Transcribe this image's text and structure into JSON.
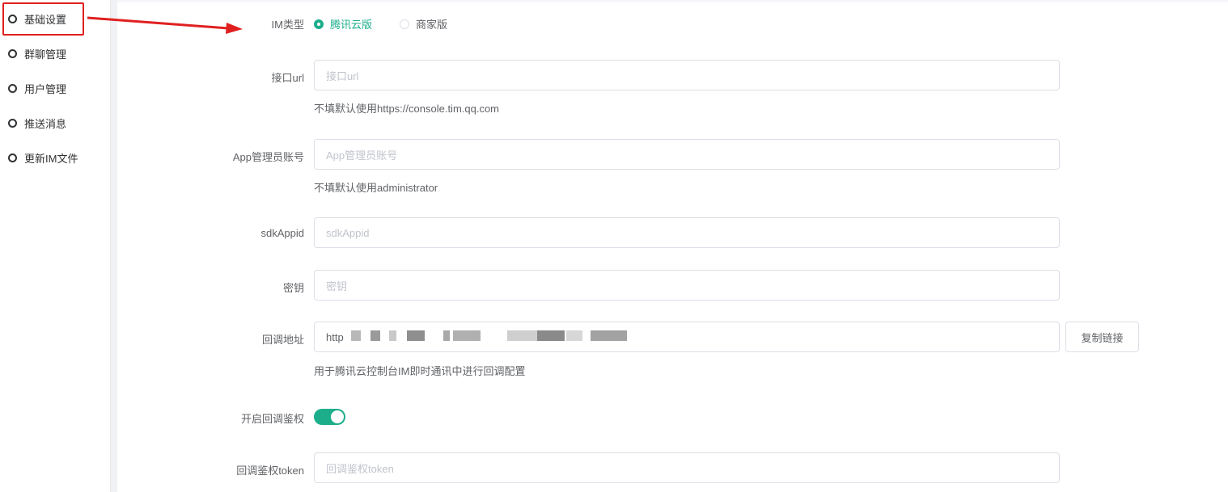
{
  "sidebar": {
    "items": [
      {
        "label": "基础设置"
      },
      {
        "label": "群聊管理"
      },
      {
        "label": "用户管理"
      },
      {
        "label": "推送消息"
      },
      {
        "label": "更新IM文件"
      }
    ]
  },
  "form": {
    "im_type": {
      "label": "IM类型",
      "options": [
        "腾讯云版",
        "商家版"
      ],
      "selected": "腾讯云版"
    },
    "api_url": {
      "label": "接口url",
      "placeholder": "接口url",
      "hint": "不填默认使用https://console.tim.qq.com"
    },
    "admin_account": {
      "label": "App管理员账号",
      "placeholder": "App管理员账号",
      "hint": "不填默认使用administrator"
    },
    "sdk_appid": {
      "label": "sdkAppid",
      "placeholder": "sdkAppid"
    },
    "secret": {
      "label": "密钥",
      "placeholder": "密钥"
    },
    "callback_url": {
      "label": "回调地址",
      "value": "http",
      "copy_button": "复制链接",
      "hint": "用于腾讯云控制台IM即时通讯中进行回调配置"
    },
    "callback_auth": {
      "label": "开启回调鉴权",
      "enabled": true
    },
    "callback_token": {
      "label": "回调鉴权token",
      "placeholder": "回调鉴权token"
    }
  },
  "colors": {
    "accent": "#1cae8b",
    "annotation": "#e02020"
  }
}
